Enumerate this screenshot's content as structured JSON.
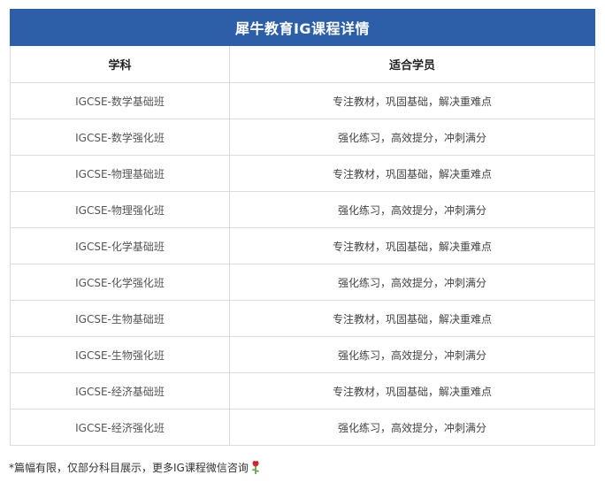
{
  "table": {
    "title": "犀牛教育IG课程详情",
    "headers": [
      "学科",
      "适合学员"
    ],
    "rows": [
      {
        "course": "IGCSE-数学基础班",
        "audience": "专注教材，巩固基础，解决重难点"
      },
      {
        "course": "IGCSE-数学强化班",
        "audience": "强化练习，高效提分，冲刺满分"
      },
      {
        "course": "IGCSE-物理基础班",
        "audience": "专注教材，巩固基础，解决重难点"
      },
      {
        "course": "IGCSE-物理强化班",
        "audience": "强化练习，高效提分，冲刺满分"
      },
      {
        "course": "IGCSE-化学基础班",
        "audience": "专注教材，巩固基础，解决重难点"
      },
      {
        "course": "IGCSE-化学强化班",
        "audience": "强化练习，高效提分，冲刺满分"
      },
      {
        "course": "IGCSE-生物基础班",
        "audience": "专注教材，巩固基础，解决重难点"
      },
      {
        "course": "IGCSE-生物强化班",
        "audience": "强化练习，高效提分，冲刺满分"
      },
      {
        "course": "IGCSE-经济基础班",
        "audience": "专注教材，巩固基础，解决重难点"
      },
      {
        "course": "IGCSE-经济强化班",
        "audience": "强化练习，高效提分，冲刺满分"
      }
    ]
  },
  "footnote": {
    "text": "*篇幅有限，仅部分科目展示，更多IG课程微信咨询",
    "icon": "rose-icon"
  },
  "colors": {
    "header_bg": "#2d5fa8",
    "header_text": "#ffffff",
    "border": "#dcdcdc"
  }
}
